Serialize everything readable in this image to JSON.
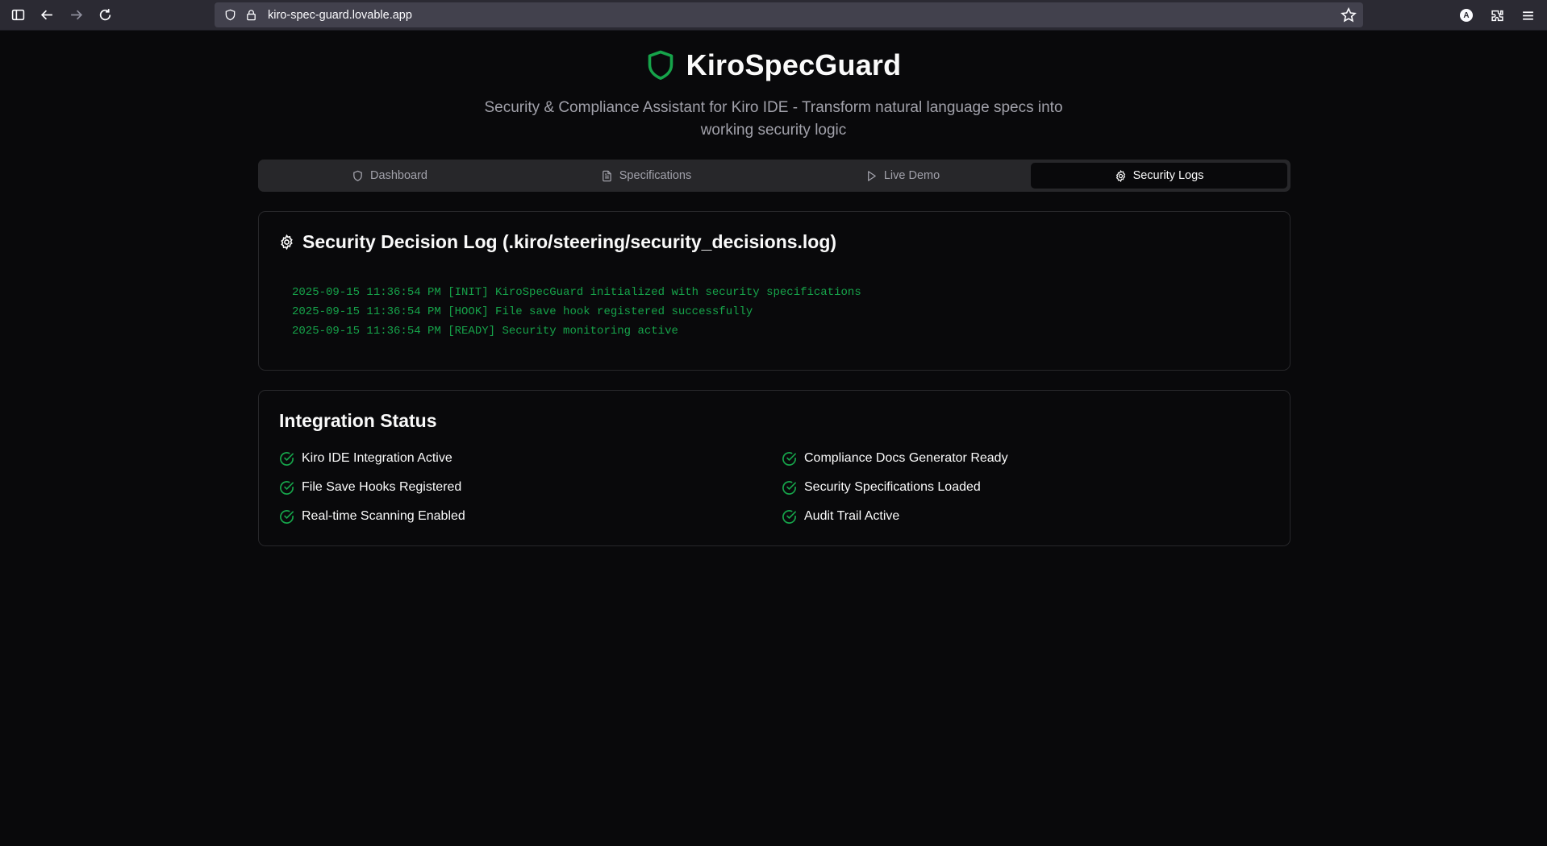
{
  "browser": {
    "url": "kiro-spec-guard.lovable.app",
    "account_initial": "A"
  },
  "header": {
    "title": "KiroSpecGuard",
    "subtitle": "Security & Compliance Assistant for Kiro IDE - Transform natural language specs into working security logic"
  },
  "tabs": [
    {
      "label": "Dashboard",
      "icon": "shield-icon",
      "active": false
    },
    {
      "label": "Specifications",
      "icon": "file-text-icon",
      "active": false
    },
    {
      "label": "Live Demo",
      "icon": "play-icon",
      "active": false
    },
    {
      "label": "Security Logs",
      "icon": "gear-icon",
      "active": true
    }
  ],
  "log_card": {
    "title": "Security Decision Log (.kiro/steering/security_decisions.log)",
    "lines": [
      "2025-09-15 11:36:54 PM [INIT] KiroSpecGuard initialized with security specifications",
      "2025-09-15 11:36:54 PM [HOOK] File save hook registered successfully",
      "2025-09-15 11:36:54 PM [READY] Security monitoring active"
    ]
  },
  "status_card": {
    "title": "Integration Status",
    "items": [
      "Kiro IDE Integration Active",
      "Compliance Docs Generator Ready",
      "File Save Hooks Registered",
      "Security Specifications Loaded",
      "Real-time Scanning Enabled",
      "Audit Trail Active"
    ]
  },
  "colors": {
    "accent": "#16a34a",
    "background": "#09090b",
    "muted_text": "#a1a1aa"
  }
}
